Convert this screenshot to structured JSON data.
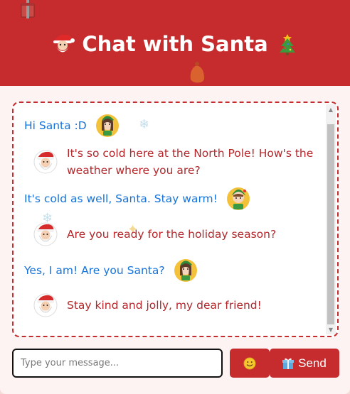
{
  "header": {
    "title": "Chat with Santa",
    "left_icon": "santa-face-icon",
    "right_icon": "christmas-tree-icon"
  },
  "colors": {
    "header_bg": "#c62b2e",
    "user_text": "#1673d9",
    "santa_text": "#b3272a",
    "page_bg": "#fdf3f2"
  },
  "messages": [
    {
      "sender": "user",
      "text": "Hi Santa :D",
      "avatar": "elf-girl-avatar"
    },
    {
      "sender": "santa",
      "text": "It's so cold here at the North Pole! How's the weather where you are?",
      "avatar": "santa-avatar"
    },
    {
      "sender": "user",
      "text": "It's cold as well, Santa. Stay warm!",
      "avatar": "elf-boy-avatar"
    },
    {
      "sender": "santa",
      "text": "Are you ready for the holiday season?",
      "avatar": "santa-avatar"
    },
    {
      "sender": "user",
      "text": "Yes, I am! Are you Santa?",
      "avatar": "elf-girl-avatar"
    },
    {
      "sender": "santa",
      "text": "Stay kind and jolly, my dear friend!",
      "avatar": "santa-avatar"
    }
  ],
  "composer": {
    "placeholder": "Type your message...",
    "emoji_button_icon": "smiley-icon",
    "send_label": "Send",
    "send_icon": "gift-icon"
  }
}
